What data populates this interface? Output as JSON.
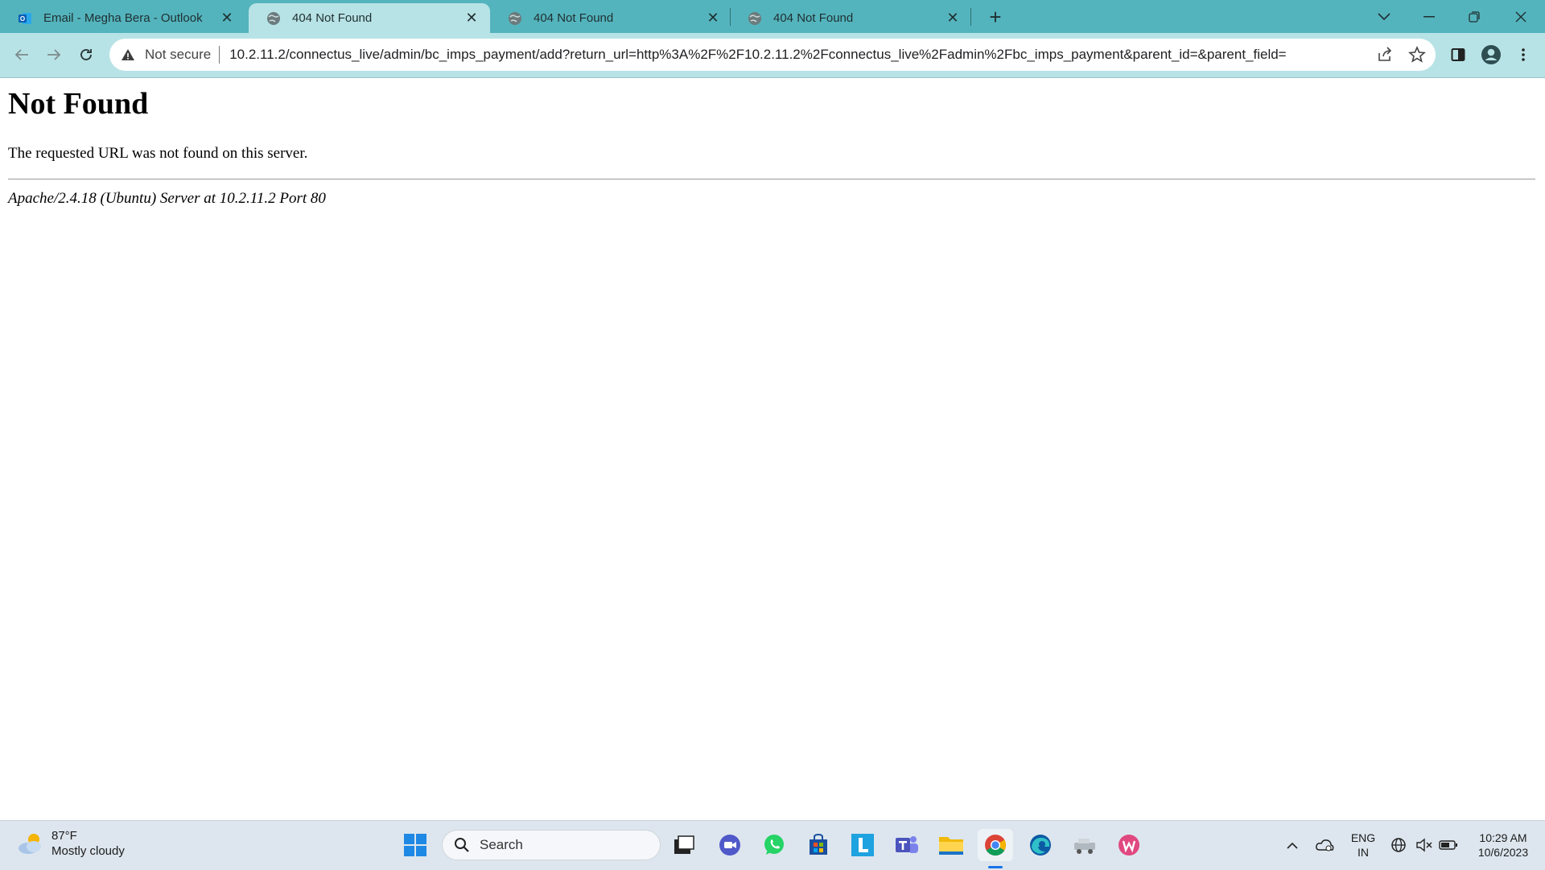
{
  "tabs": [
    {
      "title": "Email - Megha Bera - Outlook",
      "favicon": "outlook-icon",
      "active": false
    },
    {
      "title": "404 Not Found",
      "favicon": "globe-icon",
      "active": true
    },
    {
      "title": "404 Not Found",
      "favicon": "globe-icon",
      "active": false
    },
    {
      "title": "404 Not Found",
      "favicon": "globe-icon",
      "active": false
    }
  ],
  "window_controls": {
    "tab_search": "chevron-down-icon",
    "minimize": "minimize-icon",
    "restore": "restore-icon",
    "close": "close-icon"
  },
  "toolbar": {
    "security_label": "Not secure",
    "url": "10.2.11.2/connectus_live/admin/bc_imps_payment/add?return_url=http%3A%2F%2F10.2.11.2%2Fconnectus_live%2Fadmin%2Fbc_imps_payment&parent_id=&parent_field="
  },
  "page": {
    "heading": "Not Found",
    "message": "The requested URL was not found on this server.",
    "server_signature": "Apache/2.4.18 (Ubuntu) Server at 10.2.11.2 Port 80"
  },
  "taskbar": {
    "weather": {
      "temp": "87°F",
      "condition": "Mostly cloudy"
    },
    "search_label": "Search",
    "language": {
      "line1": "ENG",
      "line2": "IN"
    },
    "clock": {
      "time": "10:29 AM",
      "date": "10/6/2023"
    }
  },
  "colors": {
    "tabstrip": "#54b4bd",
    "toolbar": "#b8e3e6",
    "taskbar": "#dde6ee"
  }
}
